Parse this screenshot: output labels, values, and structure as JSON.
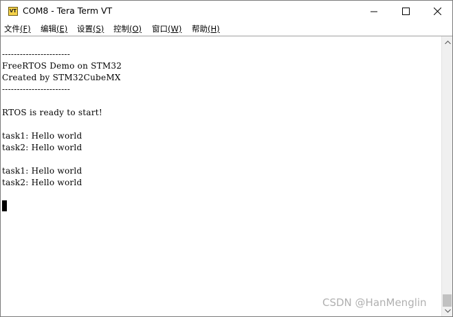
{
  "window": {
    "title": "COM8 - Tera Term VT",
    "icon": "vt-app-icon",
    "icon_label": "VT"
  },
  "menu": [
    {
      "label": "文件",
      "accel": "(F)"
    },
    {
      "label": "编辑",
      "accel": "(E)"
    },
    {
      "label": "设置",
      "accel": "(S)"
    },
    {
      "label": "控制",
      "accel": "(O)"
    },
    {
      "label": "窗口",
      "accel": "(W)"
    },
    {
      "label": "帮助",
      "accel": "(H)"
    }
  ],
  "terminal": {
    "lines": [
      "",
      "-----------------------",
      "FreeRTOS Demo on STM32",
      "Created by STM32CubeMX",
      "-----------------------",
      "",
      "RTOS is ready to start!",
      "",
      "task1: Hello world",
      "task2: Hello world",
      "",
      "task1: Hello world",
      "task2: Hello world"
    ]
  },
  "watermark": "CSDN @HanMenglin",
  "colors": {
    "background": "#ffffff",
    "text": "#000000",
    "scrollbar_track": "#f0f0f0",
    "scrollbar_thumb": "#c1c1c1"
  }
}
